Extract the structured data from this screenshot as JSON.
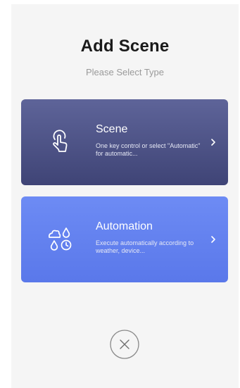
{
  "dialog": {
    "title": "Add Scene",
    "subtitle": "Please Select Type"
  },
  "options": [
    {
      "title": "Scene",
      "description": "One key control or select \"Automatic\" for automatic...",
      "icon": "tap-hand-icon",
      "color_top": "#5e6499",
      "color_bottom": "#3f4476"
    },
    {
      "title": "Automation",
      "description": "Execute automatically according to weather, device...",
      "icon": "weather-timer-icon",
      "color_top": "#6d8bf4",
      "color_bottom": "#5a78ea"
    }
  ],
  "close": {
    "icon": "close-circle-icon"
  }
}
